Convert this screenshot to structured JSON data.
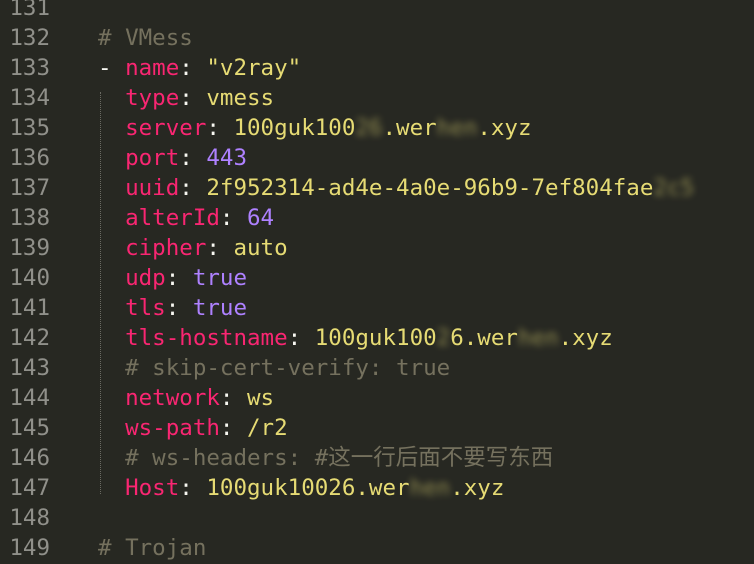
{
  "editor": {
    "lines": [
      {
        "num": "131",
        "tokens": []
      },
      {
        "num": "132",
        "tokens": [
          {
            "c": "c",
            "t": "# VMess"
          }
        ]
      },
      {
        "num": "133",
        "tokens": [
          {
            "c": "p",
            "t": "- "
          },
          {
            "c": "k",
            "t": "name"
          },
          {
            "c": "p",
            "t": ": "
          },
          {
            "c": "s",
            "t": "\"v2ray\""
          }
        ]
      },
      {
        "num": "134",
        "tokens": [
          {
            "c": "p",
            "t": "  "
          },
          {
            "c": "k",
            "t": "type"
          },
          {
            "c": "p",
            "t": ": "
          },
          {
            "c": "s",
            "t": "vmess"
          }
        ]
      },
      {
        "num": "135",
        "tokens": [
          {
            "c": "p",
            "t": "  "
          },
          {
            "c": "k",
            "t": "server"
          },
          {
            "c": "p",
            "t": ": "
          },
          {
            "c": "s",
            "t": "100guk100"
          },
          {
            "c": "s blur",
            "t": "26"
          },
          {
            "c": "s",
            "t": ".wer"
          },
          {
            "c": "s blur",
            "t": "hen"
          },
          {
            "c": "s",
            "t": ".xyz"
          }
        ]
      },
      {
        "num": "136",
        "tokens": [
          {
            "c": "p",
            "t": "  "
          },
          {
            "c": "k",
            "t": "port"
          },
          {
            "c": "p",
            "t": ": "
          },
          {
            "c": "n",
            "t": "443"
          }
        ]
      },
      {
        "num": "137",
        "tokens": [
          {
            "c": "p",
            "t": "  "
          },
          {
            "c": "k",
            "t": "uuid"
          },
          {
            "c": "p",
            "t": ": "
          },
          {
            "c": "s",
            "t": "2f952314-ad4e-4a0e-96b9-7ef804fae"
          },
          {
            "c": "s blur",
            "t": "2c5"
          }
        ]
      },
      {
        "num": "138",
        "tokens": [
          {
            "c": "p",
            "t": "  "
          },
          {
            "c": "k",
            "t": "alterId"
          },
          {
            "c": "p",
            "t": ": "
          },
          {
            "c": "n",
            "t": "64"
          }
        ]
      },
      {
        "num": "139",
        "tokens": [
          {
            "c": "p",
            "t": "  "
          },
          {
            "c": "k",
            "t": "cipher"
          },
          {
            "c": "p",
            "t": ": "
          },
          {
            "c": "s",
            "t": "auto"
          }
        ]
      },
      {
        "num": "140",
        "tokens": [
          {
            "c": "p",
            "t": "  "
          },
          {
            "c": "k",
            "t": "udp"
          },
          {
            "c": "p",
            "t": ": "
          },
          {
            "c": "n",
            "t": "true"
          }
        ]
      },
      {
        "num": "141",
        "tokens": [
          {
            "c": "p",
            "t": "  "
          },
          {
            "c": "k",
            "t": "tls"
          },
          {
            "c": "p",
            "t": ": "
          },
          {
            "c": "n",
            "t": "true"
          }
        ]
      },
      {
        "num": "142",
        "tokens": [
          {
            "c": "p",
            "t": "  "
          },
          {
            "c": "k",
            "t": "tls-hostname"
          },
          {
            "c": "p",
            "t": ": "
          },
          {
            "c": "s",
            "t": "100guk100"
          },
          {
            "c": "s blur",
            "t": "2"
          },
          {
            "c": "s",
            "t": "6.wer"
          },
          {
            "c": "s blur",
            "t": "hen"
          },
          {
            "c": "s",
            "t": ".xyz"
          }
        ]
      },
      {
        "num": "143",
        "tokens": [
          {
            "c": "p",
            "t": "  "
          },
          {
            "c": "c",
            "t": "# skip-cert-verify: true"
          }
        ]
      },
      {
        "num": "144",
        "tokens": [
          {
            "c": "p",
            "t": "  "
          },
          {
            "c": "k",
            "t": "network"
          },
          {
            "c": "p",
            "t": ": "
          },
          {
            "c": "s",
            "t": "ws"
          }
        ]
      },
      {
        "num": "145",
        "tokens": [
          {
            "c": "p",
            "t": "  "
          },
          {
            "c": "k",
            "t": "ws-path"
          },
          {
            "c": "p",
            "t": ": "
          },
          {
            "c": "s",
            "t": "/r2"
          }
        ]
      },
      {
        "num": "146",
        "tokens": [
          {
            "c": "p",
            "t": "  "
          },
          {
            "c": "c",
            "t": "# ws-headers: #这一行后面不要写东西"
          }
        ]
      },
      {
        "num": "147",
        "tokens": [
          {
            "c": "p",
            "t": "  "
          },
          {
            "c": "k",
            "t": "Host"
          },
          {
            "c": "p",
            "t": ": "
          },
          {
            "c": "s",
            "t": "100guk10026.wer"
          },
          {
            "c": "s blur",
            "t": "hen"
          },
          {
            "c": "s",
            "t": ".xyz"
          }
        ]
      },
      {
        "num": "148",
        "tokens": []
      },
      {
        "num": "149",
        "tokens": [
          {
            "c": "c",
            "t": "# Trojan"
          }
        ]
      }
    ]
  }
}
